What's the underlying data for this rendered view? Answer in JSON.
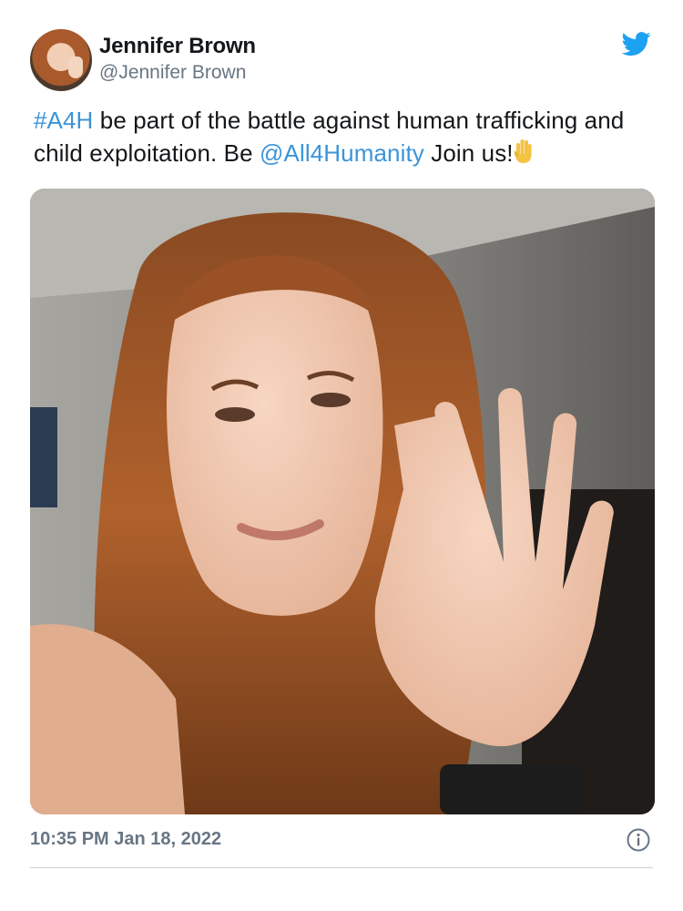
{
  "tweet": {
    "author": {
      "display_name": "Jennifer Brown",
      "handle": "@Jennifer Brown"
    },
    "text": {
      "hashtag": "#A4H",
      "part1": " be part of the battle against human trafficking and child exploitation. Be ",
      "mention": "@All4Humanity",
      "part2": " Join us!"
    },
    "timestamp": "10:35 PM Jan 18, 2022"
  },
  "colors": {
    "link": "#3b94d9",
    "twitter_blue": "#1da1f2",
    "muted": "#687684",
    "divider": "#c9d0d6"
  },
  "icons": [
    "twitter-bird-icon",
    "raised-hand-emoji",
    "info-icon"
  ]
}
